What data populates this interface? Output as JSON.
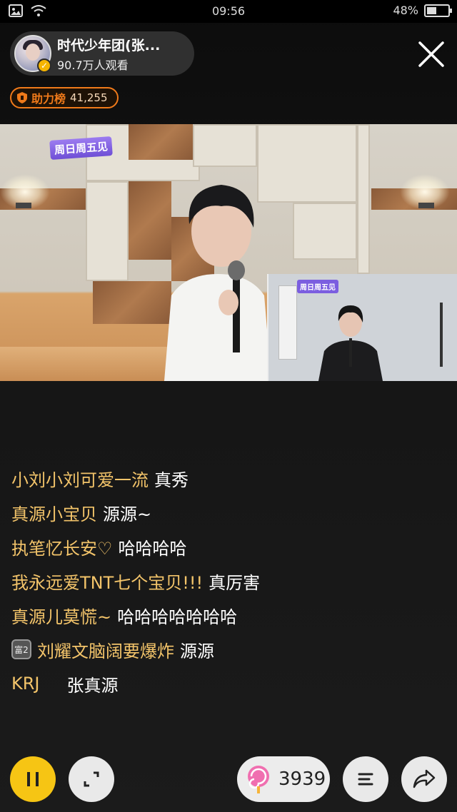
{
  "status_bar": {
    "time": "09:56",
    "battery_text": "48%",
    "battery_level": 0.48,
    "icons": [
      "image-icon",
      "wifi-icon",
      "battery-icon"
    ]
  },
  "host": {
    "name": "时代少年团(张...",
    "viewers": "90.7万人观看",
    "verified_icon": "verified-badge-icon"
  },
  "rank": {
    "label": "助力榜",
    "value": "41,255"
  },
  "video": {
    "watermark": "周日周五见",
    "pip_watermark": "周日周五见"
  },
  "chat": [
    {
      "user": "小刘小刘可爱一流",
      "text": "真秀"
    },
    {
      "user": "真源小宝贝",
      "text": "源源~"
    },
    {
      "user": "执笔忆长安♡",
      "text": "哈哈哈哈"
    },
    {
      "user": "我永远爱TNT七个宝贝!!!",
      "text": "真厉害"
    },
    {
      "user": "真源儿莫慌~",
      "text": "哈哈哈哈哈哈哈"
    },
    {
      "user": "刘耀文脑阔要爆炸",
      "text": "源源",
      "badge": "富2"
    },
    {
      "user": "KRJ",
      "text": "张真源"
    }
  ],
  "controls": {
    "gift_count": "3939",
    "icons": [
      "pause-icon",
      "fullscreen-icon",
      "lollipop-icon",
      "menu-icon",
      "share-icon"
    ]
  },
  "colors": {
    "accent_yellow": "#f6c514",
    "chat_user": "#f3c46a",
    "rank_orange": "#f07a1a"
  }
}
